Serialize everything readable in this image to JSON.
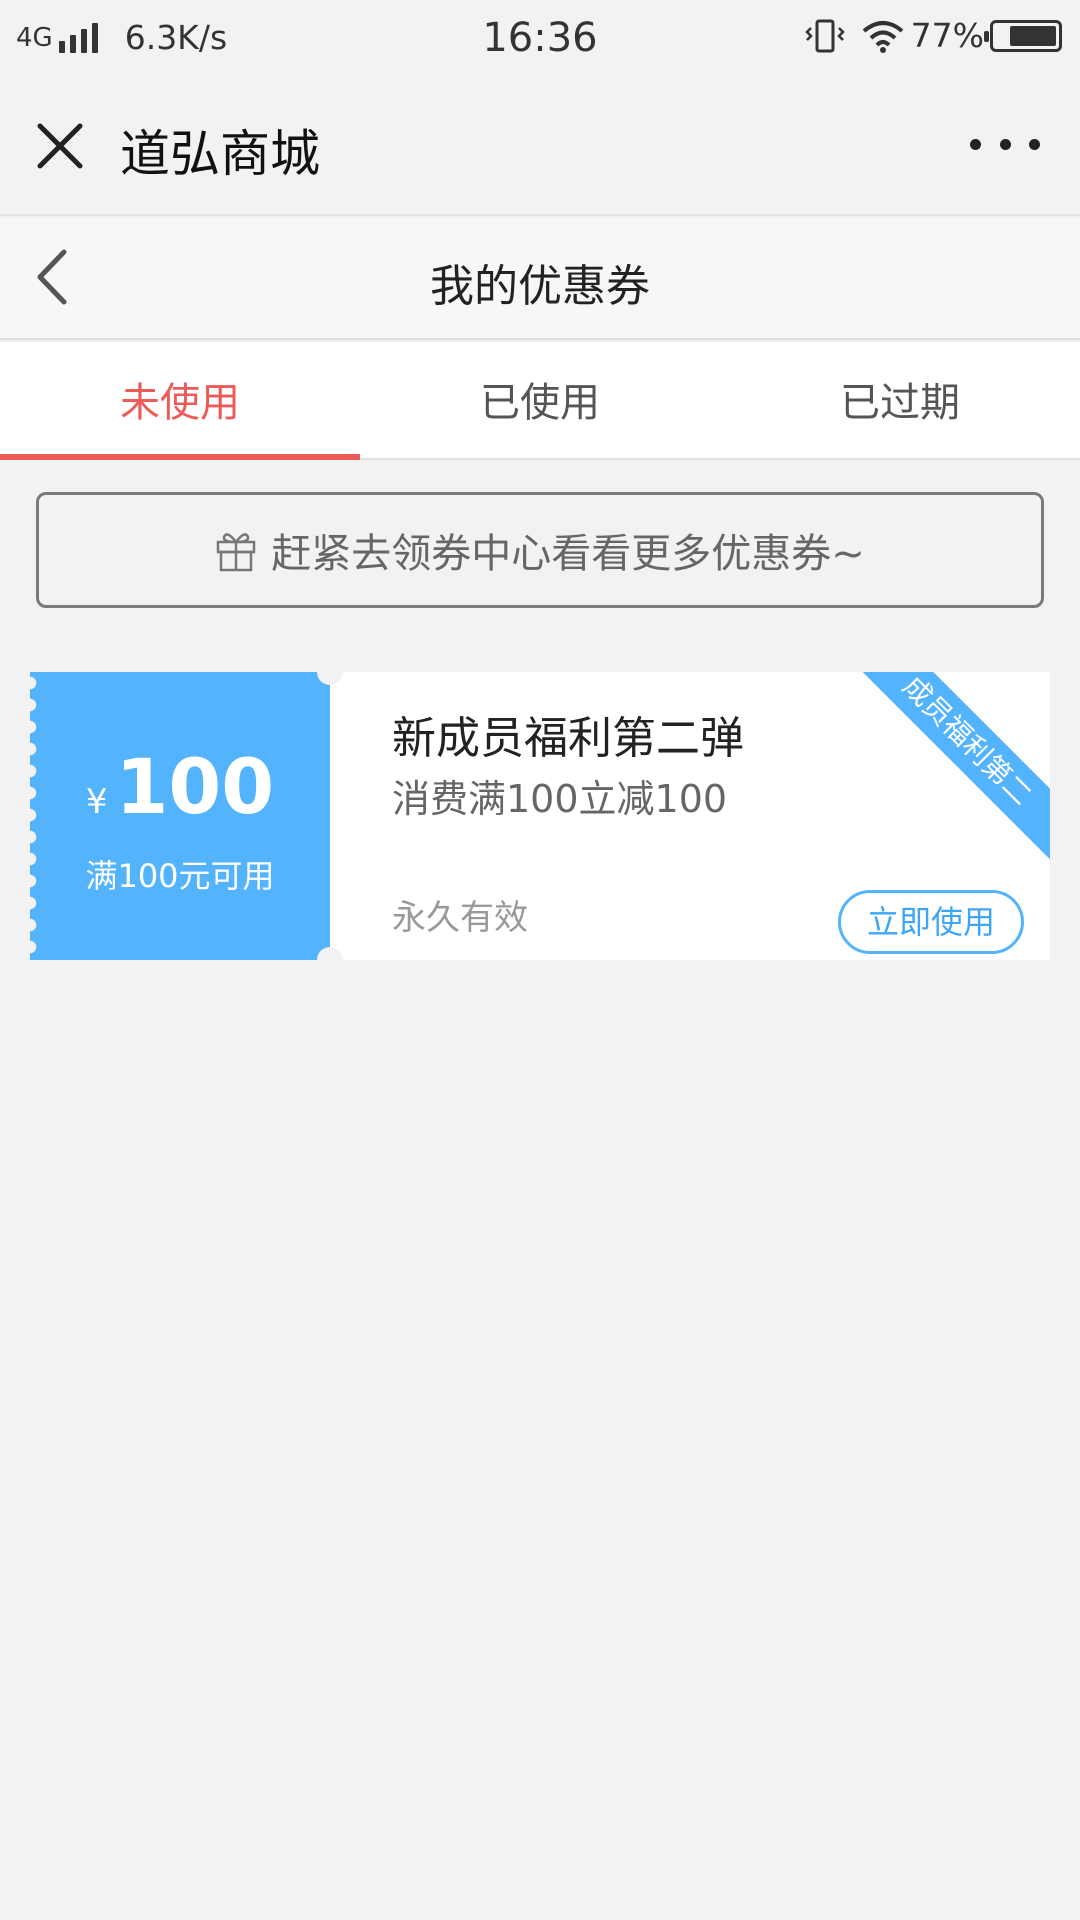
{
  "status_bar": {
    "network": "4G",
    "speed": "6.3K/s",
    "time": "16:36",
    "battery": "77%",
    "battery_level": 0.77
  },
  "header": {
    "title": "道弘商城"
  },
  "page": {
    "title": "我的优惠券"
  },
  "tabs": [
    {
      "label": "未使用",
      "active": true
    },
    {
      "label": "已使用",
      "active": false
    },
    {
      "label": "已过期",
      "active": false
    }
  ],
  "banner": {
    "text": "赶紧去领券中心看看更多优惠券~"
  },
  "coupons": [
    {
      "currency": "¥",
      "amount": "100",
      "condition": "满100元可用",
      "title": "新成员福利第二弹",
      "description": "消费满100立减100",
      "validity": "永久有效",
      "button": "立即使用",
      "ribbon": "成员福利第二"
    }
  ],
  "colors": {
    "accent": "#ee5a57",
    "coupon_blue": "#54b3fd",
    "background": "#f2f2f2"
  }
}
